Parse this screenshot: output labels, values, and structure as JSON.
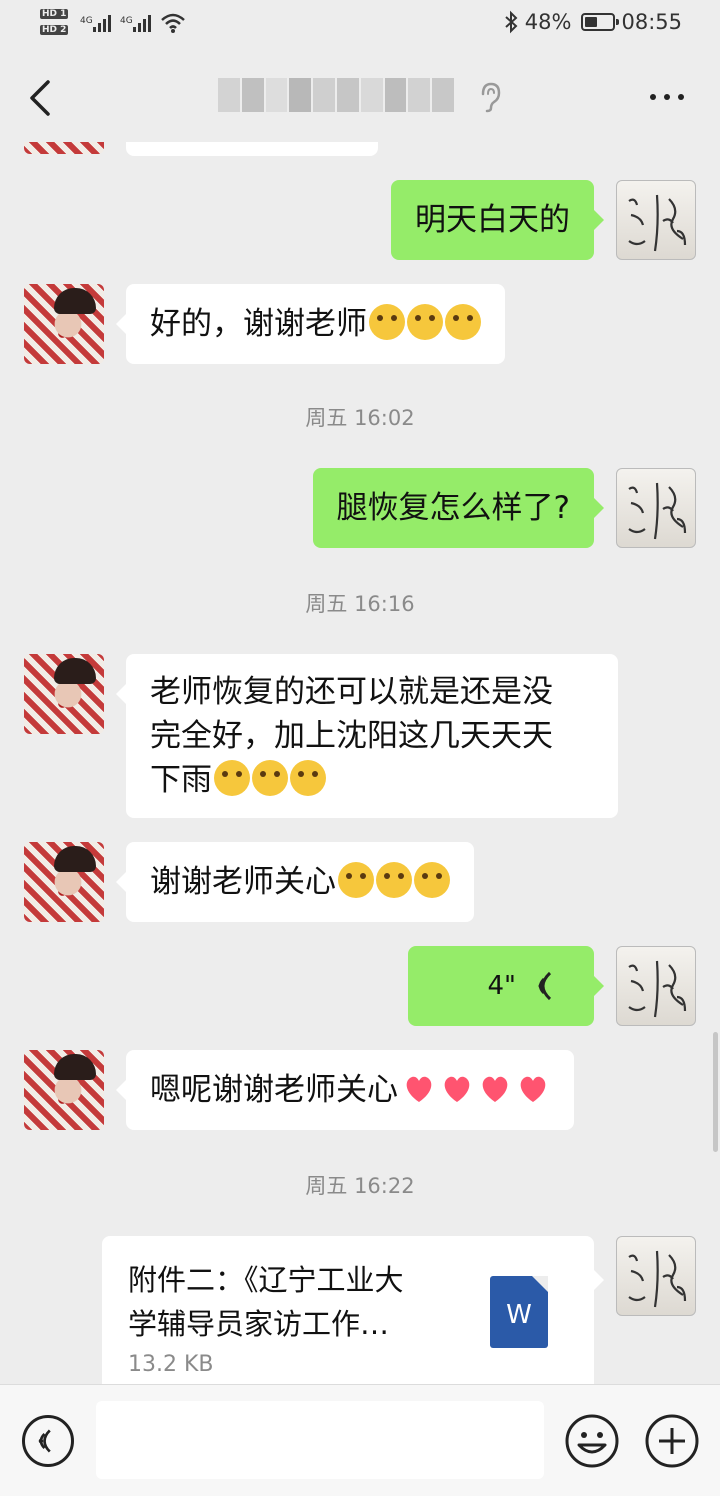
{
  "status_bar": {
    "sim1": "HD 1",
    "sim2": "HD 2",
    "network1": "4G",
    "network2": "4G",
    "battery": "48%",
    "battery_level": 0.48,
    "time": "08:55"
  },
  "header": {
    "contact_name_blurred": true
  },
  "messages": [
    {
      "side": "out",
      "text": "明天白天的"
    },
    {
      "side": "in",
      "text": "好的，谢谢老师",
      "emoji": [
        "crying-emoji",
        "crying-emoji",
        "crying-emoji"
      ]
    },
    {
      "type": "time",
      "text": "周五 16:02"
    },
    {
      "side": "out",
      "text": "腿恢复怎么样了?"
    },
    {
      "type": "time",
      "text": "周五 16:16"
    },
    {
      "side": "in",
      "text_lines": [
        "老师恢复的还可以就是还是没",
        "完全好，加上沈阳这几天天天",
        "下雨"
      ],
      "emoji": [
        "sob-emoji",
        "sob-emoji",
        "sob-emoji"
      ]
    },
    {
      "side": "in",
      "text": "谢谢老师关心",
      "emoji": [
        "pleading-emoji",
        "pleading-emoji",
        "pleading-emoji"
      ]
    },
    {
      "side": "out",
      "type": "voice",
      "duration": "4\""
    },
    {
      "side": "in",
      "text": "嗯呢谢谢老师关心",
      "emoji": [
        "heart-icon",
        "heart-icon",
        "heart-icon",
        "heart-icon"
      ]
    },
    {
      "type": "time",
      "text": "周五 16:22"
    },
    {
      "side": "out",
      "type": "file",
      "name_lines": [
        "附件二：《辽宁工业大",
        "学辅导员家访工作…"
      ],
      "size": "13.2 KB",
      "file_type_label": "W"
    }
  ],
  "colors": {
    "background": "#ededed",
    "outgoing_bubble": "#95ec69",
    "incoming_bubble": "#ffffff",
    "timestamp": "#8a8a8a",
    "word_icon": "#2b5aa8",
    "heart": "#ff5470"
  },
  "icons": {
    "back": "chevron-left-icon",
    "muted": "ear-icon",
    "more": "more-dots-icon",
    "voice_wave": "voice-wave-icon",
    "voice_input": "voice-input-icon",
    "emoji": "emoji-icon",
    "plus": "plus-icon"
  }
}
